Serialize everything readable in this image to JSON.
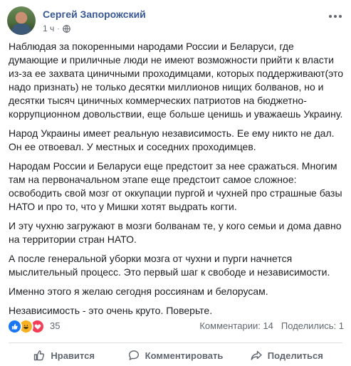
{
  "post": {
    "author": "Сергей Запорожский",
    "time": "1 ч",
    "paragraphs": [
      "Наблюдая за покоренными народами России и Беларуси, где думающие и приличные люди не имеют возможности прийти к власти из-за ее захвата циничными проходимцами, которых поддерживают(это надо признать) не только десятки миллионов нищих болванов, но и десятки тысяч циничных коммерческих патриотов на бюджетно-коррупционном довольствии, еще больше ценишь и уважаешь Украину.",
      "Народ Украины имеет реальную независимость. Ее ему никто не дал. Он ее отвоевал. У местных и соседних проходимцев.",
      "Народам России и Беларуси еще предстоит за нее сражаться. Многим там на первоначальном этапе еще предстоит самое сложное: освободить свой мозг от оккупации пургой и чухней про страшные базы НАТО и про то, что у Мишки хотят выдрать когти.",
      "И эту чухню загружают в мозги болванам те, у кого семьи и дома давно на территории стран НАТО.",
      "А после генеральной уборки мозга от чухни и пурги начнется мыслительный процесс. Это первый шаг к свободе и независимости.",
      "Именно этого я желаю сегодня россиянам и белорусам.",
      "Независимость - это очень круто. Поверьте."
    ]
  },
  "reactions": {
    "count": "35",
    "icons": [
      "like-icon",
      "haha-icon",
      "love-icon"
    ]
  },
  "stats": {
    "comments": "Комментарии: 14",
    "shares": "Поделились: 1"
  },
  "actions": {
    "like": "Нравится",
    "comment": "Комментировать",
    "share": "Поделиться"
  },
  "colors": {
    "author_link": "#385898",
    "like": "#1877f2",
    "haha": "#f7b125",
    "love": "#f33e58",
    "muted_text": "#606770"
  }
}
